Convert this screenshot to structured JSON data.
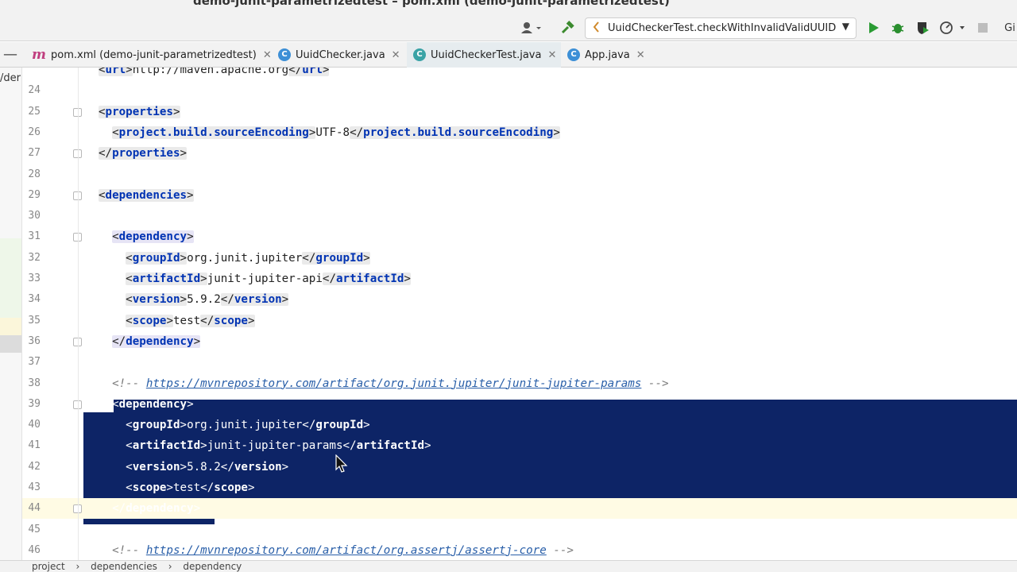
{
  "window": {
    "title": "demo-junit-parametrizedtest – pom.xml (demo-junit-parametrizedtest)"
  },
  "toolbar": {
    "run_config": "UuidCheckerTest.checkWithInvalidValidUUID",
    "right_cut_label": "Gi",
    "icons": [
      "user-icon",
      "build-hammer-icon",
      "run-icon",
      "debug-icon",
      "coverage-icon",
      "profiler-icon",
      "stop-icon"
    ]
  },
  "tabs": [
    {
      "label": "pom.xml (demo-junit-parametrizedtest)",
      "icon": "maven-m-icon",
      "active": false
    },
    {
      "label": "UuidChecker.java",
      "icon": "class-icon",
      "active": false
    },
    {
      "label": "UuidCheckerTest.java",
      "icon": "test-class-icon",
      "active": true
    },
    {
      "label": "App.java",
      "icon": "class-icon",
      "active": false
    }
  ],
  "left_strip": {
    "label": "/der"
  },
  "editor": {
    "lines": [
      {
        "n": "",
        "text": "<url>http://maven.apache.org</url>"
      },
      {
        "n": "24",
        "text": ""
      },
      {
        "n": "25",
        "text": "<properties>"
      },
      {
        "n": "26",
        "text": "  <project.build.sourceEncoding>UTF-8</project.build.sourceEncoding>"
      },
      {
        "n": "27",
        "text": "</properties>"
      },
      {
        "n": "28",
        "text": ""
      },
      {
        "n": "29",
        "text": "<dependencies>"
      },
      {
        "n": "30",
        "text": ""
      },
      {
        "n": "31",
        "text": "  <dependency>"
      },
      {
        "n": "32",
        "text": "    <groupId>org.junit.jupiter</groupId>"
      },
      {
        "n": "33",
        "text": "    <artifactId>junit-jupiter-api</artifactId>"
      },
      {
        "n": "34",
        "text": "    <version>5.9.2</version>"
      },
      {
        "n": "35",
        "text": "    <scope>test</scope>"
      },
      {
        "n": "36",
        "text": "  </dependency>"
      },
      {
        "n": "37",
        "text": ""
      },
      {
        "n": "38",
        "text": "  <!-- https://mvnrepository.com/artifact/org.junit.jupiter/junit-jupiter-params -->"
      },
      {
        "n": "39",
        "text": "  <dependency>"
      },
      {
        "n": "40",
        "text": "    <groupId>org.junit.jupiter</groupId>"
      },
      {
        "n": "41",
        "text": "    <artifactId>junit-jupiter-params</artifactId>"
      },
      {
        "n": "42",
        "text": "    <version>5.8.2</version>"
      },
      {
        "n": "43",
        "text": "    <scope>test</scope>"
      },
      {
        "n": "44",
        "text": "  </dependency>"
      },
      {
        "n": "45",
        "text": ""
      },
      {
        "n": "46",
        "text": "  <!-- https://mvnrepository.com/artifact/org.assertj/assertj-core -->"
      }
    ],
    "selected_lines": [
      "39",
      "40",
      "41",
      "42",
      "43",
      "44"
    ],
    "caret_line": "44"
  },
  "breadcrumbs": [
    "project",
    "dependencies",
    "dependency"
  ],
  "colors": {
    "selection": "#0d2466",
    "tag_name": "#0033b3",
    "comment": "#7a7a7a",
    "link": "#285ea8",
    "caret_line": "#fffbe4"
  }
}
